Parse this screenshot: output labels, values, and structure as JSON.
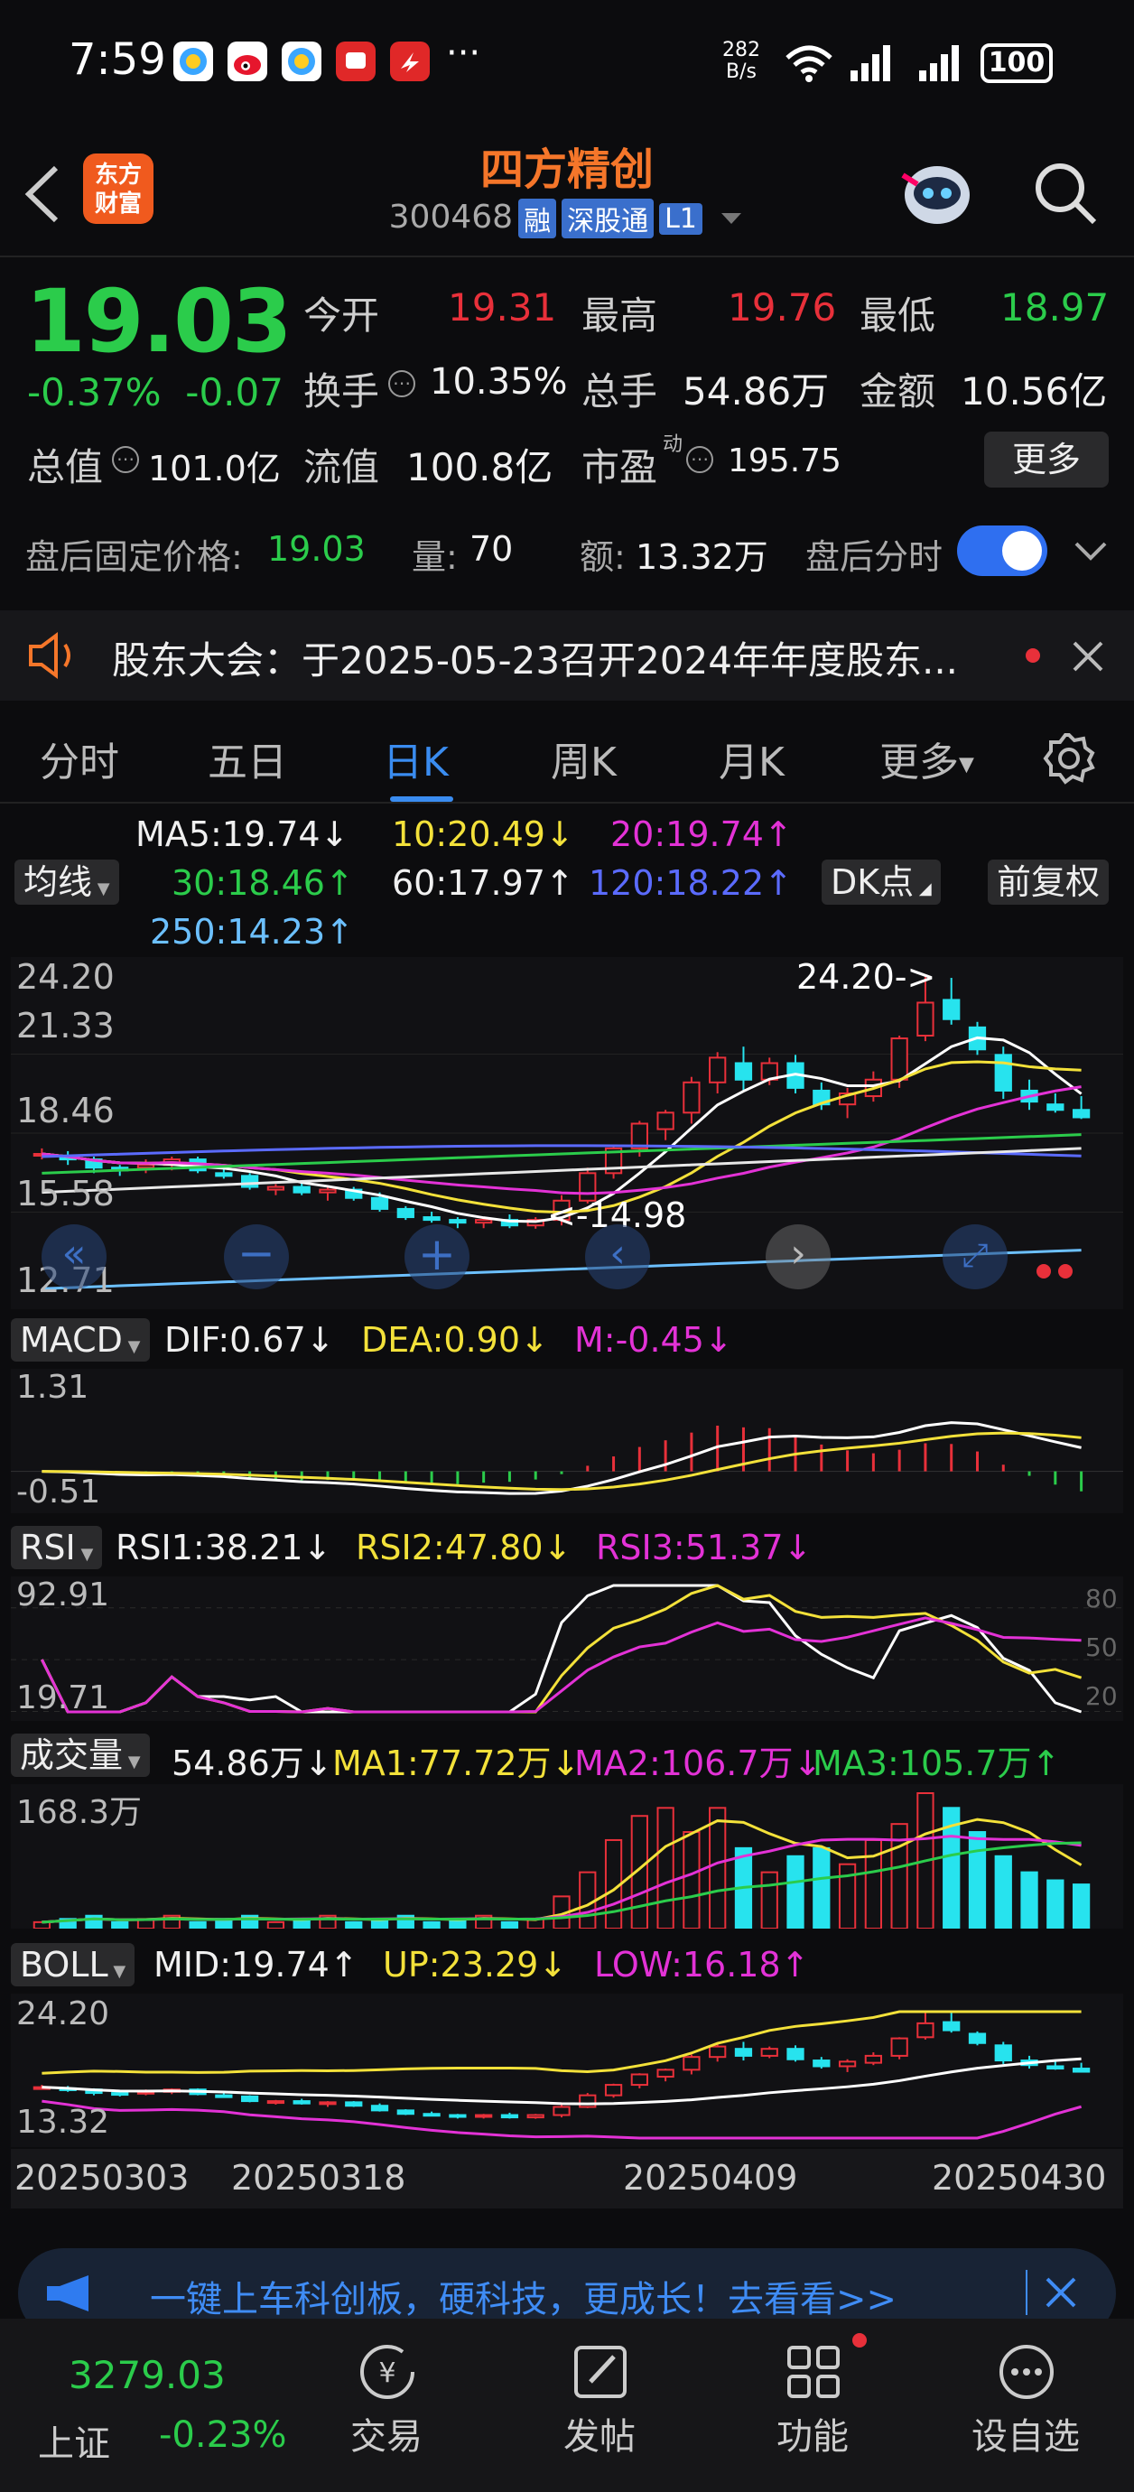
{
  "status_bar": {
    "time": "7:59",
    "net_speed_top": "282",
    "net_speed_bottom": "B/s",
    "battery": "100",
    "more": "···"
  },
  "header": {
    "brand_line1": "东方",
    "brand_line2": "财富",
    "stock_name": "四方精创",
    "stock_code": "300468",
    "tags": [
      "融",
      "深股通",
      "L1"
    ]
  },
  "quote": {
    "price": "19.03",
    "change_pct": "-0.37%",
    "change_amt": "-0.07",
    "open_label": "今开",
    "open": "19.31",
    "high_label": "最高",
    "high": "19.76",
    "low_label": "最低",
    "low": "18.97",
    "turnover_label": "换手",
    "turnover": "10.35%",
    "volume_label": "总手",
    "volume": "54.86万",
    "amount_label": "金额",
    "amount": "10.56亿",
    "mktcap_label": "总值",
    "mktcap": "101.0亿",
    "float_label": "流值",
    "float": "100.8亿",
    "pe_label": "市盈",
    "pe_sup": "动",
    "pe": "195.75",
    "more_label": "更多"
  },
  "after_hours": {
    "fixed_price_label": "盘后固定价格:",
    "fixed_price": "19.03",
    "vol_label": "量:",
    "vol": "70",
    "amt_label": "额:",
    "amt": "13.32万",
    "toggle_label": "盘后分时",
    "toggle_on": true
  },
  "notice": {
    "text": "股东大会：于2025-05-23召开2024年年度股东..."
  },
  "tabs": [
    {
      "label": "分时"
    },
    {
      "label": "五日"
    },
    {
      "label": "日K"
    },
    {
      "label": "周K"
    },
    {
      "label": "月K"
    },
    {
      "label": "更多"
    }
  ],
  "active_tab": "日K",
  "ma": {
    "select": "均线",
    "ma5": "MA5:19.74↓",
    "ma10": "10:20.49↓",
    "ma20": "20:19.74↑",
    "ma30": "30:18.46↑",
    "ma60": "60:17.97↑",
    "ma120": "120:18.22↑",
    "ma250": "250:14.23↑",
    "dk": "DK点",
    "adj": "前复权"
  },
  "kline_axis": [
    "24.20",
    "21.33",
    "18.46",
    "15.58",
    "12.71"
  ],
  "kline_marks": {
    "high": "24.20->",
    "low": "<-14.98"
  },
  "macd": {
    "select": "MACD",
    "dif": "DIF:0.67↓",
    "dea": "DEA:0.90↓",
    "m": "M:-0.45↓",
    "axis_top": "1.31",
    "axis_bottom": "-0.51"
  },
  "rsi": {
    "select": "RSI",
    "rsi1": "RSI1:38.21↓",
    "rsi2": "RSI2:47.80↓",
    "rsi3": "RSI3:51.37↓",
    "axis_top": "92.91",
    "axis_bottom": "19.71",
    "guide_80": "80",
    "guide_50": "50",
    "guide_20": "20"
  },
  "vol": {
    "select": "成交量",
    "v": "54.86万↓",
    "ma1": "MA1:77.72万↓",
    "ma2": "MA2:106.7万↓",
    "ma3": "MA3:105.7万↑",
    "axis_top": "168.3万"
  },
  "boll": {
    "select": "BOLL",
    "mid": "MID:19.74↑",
    "up": "UP:23.29↓",
    "low": "LOW:16.18↑",
    "axis_top": "24.20",
    "axis_bottom": "13.32"
  },
  "dates": [
    "20250303",
    "20250318",
    "20250409",
    "20250430"
  ],
  "banner": {
    "text": "一键上车科创板，硬科技，更成长！去看看>>"
  },
  "bottom_nav": {
    "index_value": "3279.03",
    "index_name": "上证",
    "index_change": "-0.23%",
    "items": [
      "交易",
      "发帖",
      "功能",
      "设自选"
    ]
  },
  "colors": {
    "up": "#e8303a",
    "down": "#2bcc4b",
    "accent": "#3a8cf0",
    "brand": "#f5762a"
  },
  "chart_data": {
    "type": "candlestick",
    "dates": [
      "20250303",
      "20250318",
      "20250409",
      "20250430"
    ],
    "kline": {
      "ylim": [
        12.71,
        24.2
      ],
      "candles": [
        [
          17.7,
          17.9,
          17.5,
          17.7
        ],
        [
          17.6,
          17.8,
          17.3,
          17.5
        ],
        [
          17.5,
          17.6,
          17.0,
          17.2
        ],
        [
          17.2,
          17.3,
          16.9,
          17.1
        ],
        [
          17.2,
          17.5,
          17.0,
          17.3
        ],
        [
          17.3,
          17.6,
          17.1,
          17.5
        ],
        [
          17.5,
          17.6,
          17.0,
          17.1
        ],
        [
          17.0,
          17.2,
          16.8,
          16.9
        ],
        [
          16.9,
          17.0,
          16.4,
          16.5
        ],
        [
          16.4,
          16.6,
          16.2,
          16.5
        ],
        [
          16.5,
          16.7,
          16.2,
          16.3
        ],
        [
          16.3,
          16.5,
          16.0,
          16.4
        ],
        [
          16.4,
          16.5,
          16.0,
          16.1
        ],
        [
          16.1,
          16.3,
          15.6,
          15.7
        ],
        [
          15.7,
          15.8,
          15.3,
          15.4
        ],
        [
          15.4,
          15.6,
          15.2,
          15.3
        ],
        [
          15.3,
          15.4,
          15.0,
          15.2
        ],
        [
          15.2,
          15.4,
          15.0,
          15.3
        ],
        [
          15.3,
          15.5,
          15.0,
          15.1
        ],
        [
          15.1,
          15.4,
          14.98,
          15.3
        ],
        [
          15.3,
          16.2,
          15.1,
          16.0
        ],
        [
          16.0,
          17.2,
          15.9,
          17.0
        ],
        [
          17.0,
          18.0,
          16.8,
          17.9
        ],
        [
          17.9,
          18.9,
          17.6,
          18.8
        ],
        [
          18.6,
          19.3,
          18.2,
          19.2
        ],
        [
          19.2,
          20.5,
          18.8,
          20.3
        ],
        [
          20.3,
          21.4,
          19.9,
          21.2
        ],
        [
          21.0,
          21.6,
          20.0,
          20.4
        ],
        [
          20.4,
          21.2,
          20.2,
          21.0
        ],
        [
          21.0,
          21.3,
          19.9,
          20.1
        ],
        [
          20.0,
          20.3,
          19.3,
          19.5
        ],
        [
          19.5,
          20.1,
          19.0,
          19.9
        ],
        [
          19.8,
          20.7,
          19.6,
          20.4
        ],
        [
          20.4,
          22.0,
          20.1,
          21.9
        ],
        [
          22.0,
          24.2,
          21.8,
          23.2
        ],
        [
          23.3,
          24.1,
          22.4,
          22.6
        ],
        [
          22.3,
          22.5,
          21.3,
          21.5
        ],
        [
          21.3,
          21.6,
          19.7,
          20.0
        ],
        [
          20.0,
          20.4,
          19.3,
          19.6
        ],
        [
          19.5,
          19.9,
          19.2,
          19.3
        ],
        [
          19.3,
          19.8,
          18.97,
          19.03
        ]
      ]
    },
    "macd_range": [
      -0.51,
      1.31
    ],
    "rsi_range": [
      19.71,
      92.91
    ],
    "volume_max_wan": 168.3
  }
}
